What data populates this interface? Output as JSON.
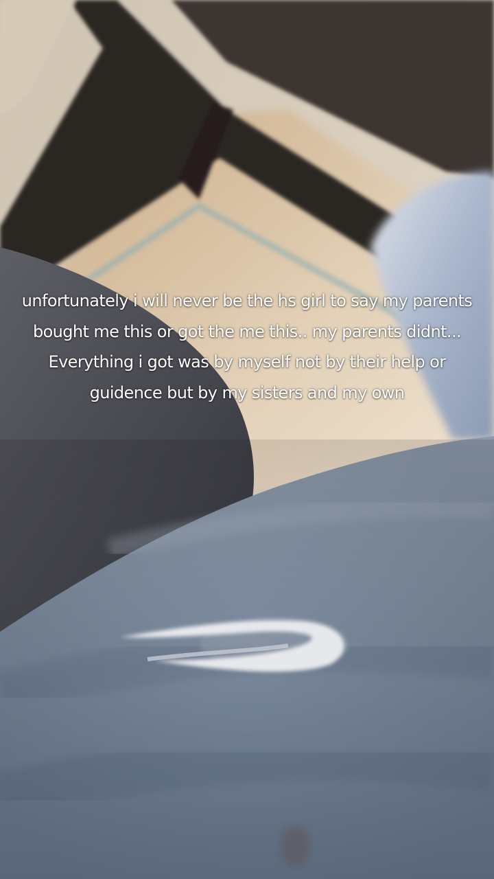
{
  "overlay": {
    "caption": "unfortunately i will never be the hs girl to say my parents bought me this or got the me this.. my parents didnt... Everything i got was by myself not by their help or guidence but by my sisters and my own"
  },
  "colors": {
    "wall": "#d9cdbd",
    "floor": "#d7c0a2",
    "chair_wood": "#2a2422",
    "pants_dark": "#4e4f56",
    "sweatpants_blue": "#7f8c9e",
    "logo": "#e4e6ea"
  }
}
